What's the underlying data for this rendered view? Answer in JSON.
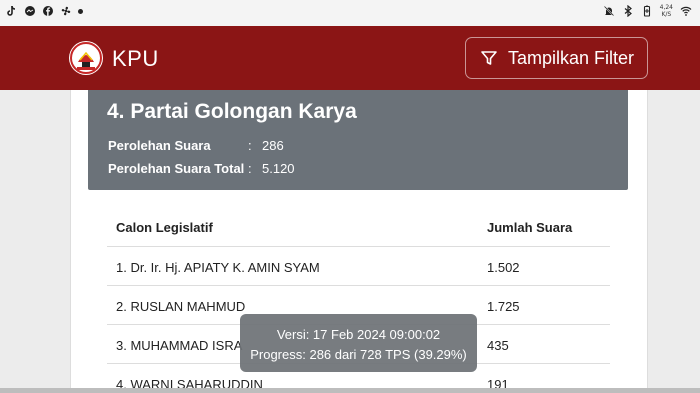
{
  "statusbar": {
    "left_icons": [
      "tiktok-icon",
      "messenger-icon",
      "facebook-icon",
      "fan-icon"
    ],
    "speed_value": "4,24",
    "speed_unit": "K/S"
  },
  "header": {
    "brand": "KPU",
    "filter_button": "Tampilkan Filter"
  },
  "party": {
    "title": "4. Partai Golongan Karya",
    "perolehan_label": "Perolehan Suara",
    "perolehan_value": "286",
    "total_label": "Perolehan Suara Total",
    "total_value": "5.120",
    "separator": ":"
  },
  "table": {
    "headers": [
      "Calon Legislatif",
      "Jumlah Suara"
    ],
    "rows": [
      {
        "name": "1. Dr. Ir. Hj. APIATY K. AMIN SYAM",
        "votes": "1.502"
      },
      {
        "name": "2. RUSLAN MAHMUD",
        "votes": "1.725"
      },
      {
        "name": "3. MUHAMMAD ISRA",
        "votes": "435"
      },
      {
        "name": "4. WARNI SAHARUDDIN",
        "votes": "191"
      }
    ]
  },
  "tooltip": {
    "line1": "Versi: 17 Feb 2024 09:00:02",
    "line2": "Progress: 286 dari 728 TPS (39.29%)"
  },
  "colors": {
    "header_bg": "#8b1515",
    "party_bg": "#6b7279"
  }
}
